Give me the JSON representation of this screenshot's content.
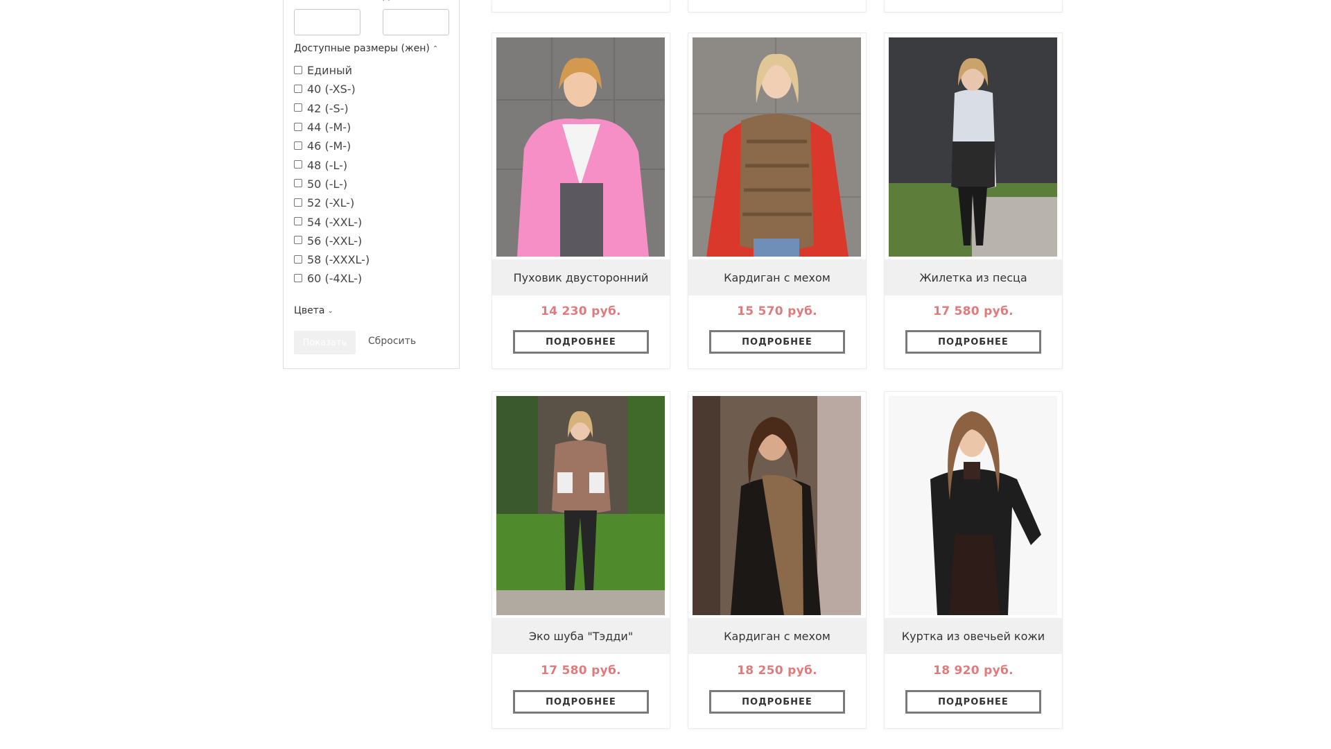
{
  "filter": {
    "price_from_label": "От",
    "price_to_label": "До",
    "sizes_title": "Доступные размеры (жен)",
    "sizes": [
      "Единый",
      "40 (-XS-)",
      "42 (-S-)",
      "44 (-M-)",
      "46 (-M-)",
      "48 (-L-)",
      "50 (-L-)",
      "52 (-XL-)",
      "54 (-XXL-)",
      "56 (-XXL-)",
      "58 (-XXXL-)",
      "60 (-4XL-)"
    ],
    "colors_title": "Цвета",
    "show_label": "Показать",
    "reset_label": "Сбросить"
  },
  "products": [
    {
      "title": "Пуховик двусторонний",
      "price": "14 230 руб.",
      "button": "ПОДРОБНЕЕ"
    },
    {
      "title": "Кардиган с мехом",
      "price": "15 570 руб.",
      "button": "ПОДРОБНЕЕ"
    },
    {
      "title": "Жилетка из песца",
      "price": "17 580 руб.",
      "button": "ПОДРОБНЕЕ"
    },
    {
      "title": "Эко шуба \"Тэдди\"",
      "price": "17 580 руб.",
      "button": "ПОДРОБНЕЕ"
    },
    {
      "title": "Кардиган с мехом",
      "price": "18 250 руб.",
      "button": "ПОДРОБНЕЕ"
    },
    {
      "title": "Куртка из овечьей кожи",
      "price": "18 920 руб.",
      "button": "ПОДРОБНЕЕ"
    }
  ],
  "colors": {
    "price": "#e07b7b",
    "title_band": "#f0f0f0",
    "button_border": "#7a7a7a"
  }
}
